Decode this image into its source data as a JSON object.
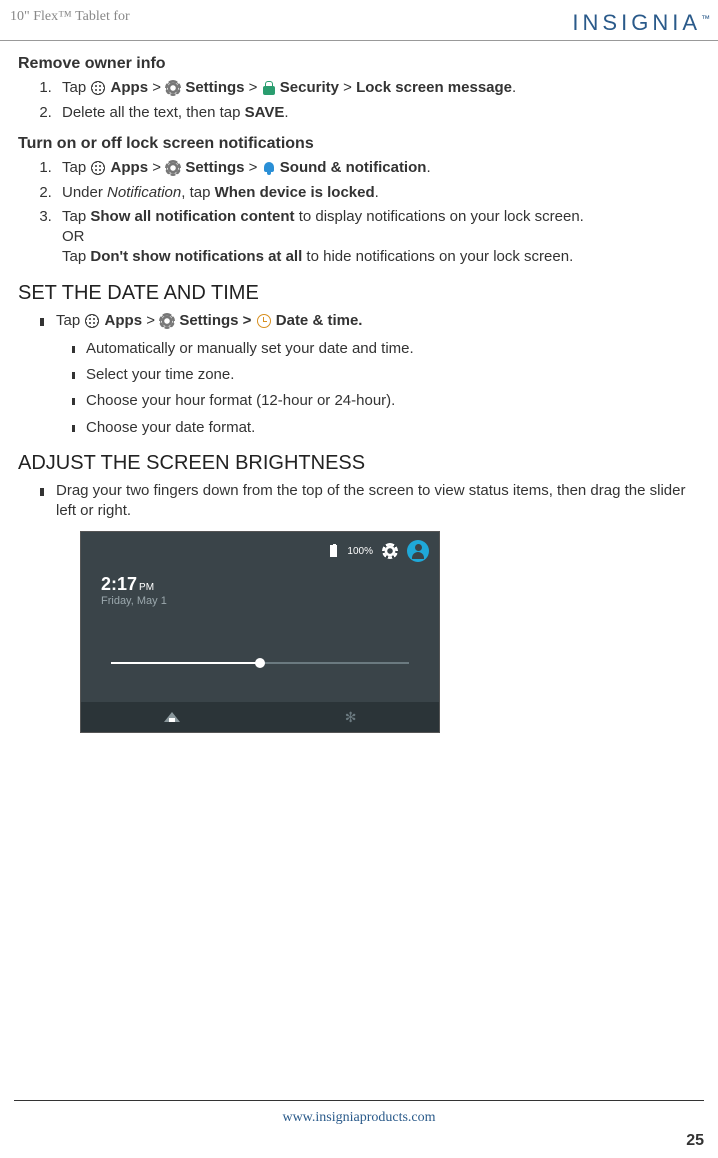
{
  "header": {
    "left": "10\" Flex™ Tablet for",
    "brand": "INSIGNIA",
    "tm": "™"
  },
  "sec1": {
    "title": "Remove owner info",
    "step1_a": "Tap ",
    "step1_apps": "Apps",
    "step1_gt1": " > ",
    "step1_settings": " Settings",
    "step1_gt2": " > ",
    "step1_security": "Security",
    "step1_gt3": " > ",
    "step1_lock": "Lock screen message",
    "step1_dot": ".",
    "step2_a": "Delete all the text, then tap ",
    "step2_save": "SAVE",
    "step2_dot": "."
  },
  "sec2": {
    "title": "Turn on or off lock screen notifications",
    "s1_a": "Tap ",
    "s1_apps": "Apps",
    "s1_gt1": " > ",
    "s1_settings": " Settings",
    "s1_gt2": " > ",
    "s1_sound": "Sound & notification",
    "s1_dot": ".",
    "s2_a": "Under ",
    "s2_notif": "Notification",
    "s2_b": ", tap ",
    "s2_when": "When device is locked",
    "s2_dot": ".",
    "s3_a": "Tap ",
    "s3_show": "Show all notification content",
    "s3_b": " to display notifications on your lock screen.",
    "s3_or": "OR",
    "s3_c": "Tap ",
    "s3_dont": "Don't show notifications at all",
    "s3_d": " to hide notifications on your lock screen."
  },
  "sec3": {
    "title": "SET THE DATE AND TIME",
    "b1_a": "Tap ",
    "b1_apps": "Apps",
    "b1_gt1": " > ",
    "b1_settings": " Settings > ",
    "b1_date": "Date & time.",
    "sub1": "Automatically or manually set your date and time.",
    "sub2": "Select your time zone.",
    "sub3": "Choose your hour format (12-hour or 24-hour).",
    "sub4": "Choose your date format."
  },
  "sec4": {
    "title": "ADJUST THE SCREEN BRIGHTNESS",
    "b1": "Drag your two fingers down from the top of the screen to view status items, then drag the slider left or right."
  },
  "shot": {
    "battery": "100%",
    "time": "2:17",
    "ampm": "PM",
    "date": "Friday, May 1",
    "bt": "✻"
  },
  "footer": {
    "url": "www.insigniaproducts.com",
    "page": "25"
  }
}
